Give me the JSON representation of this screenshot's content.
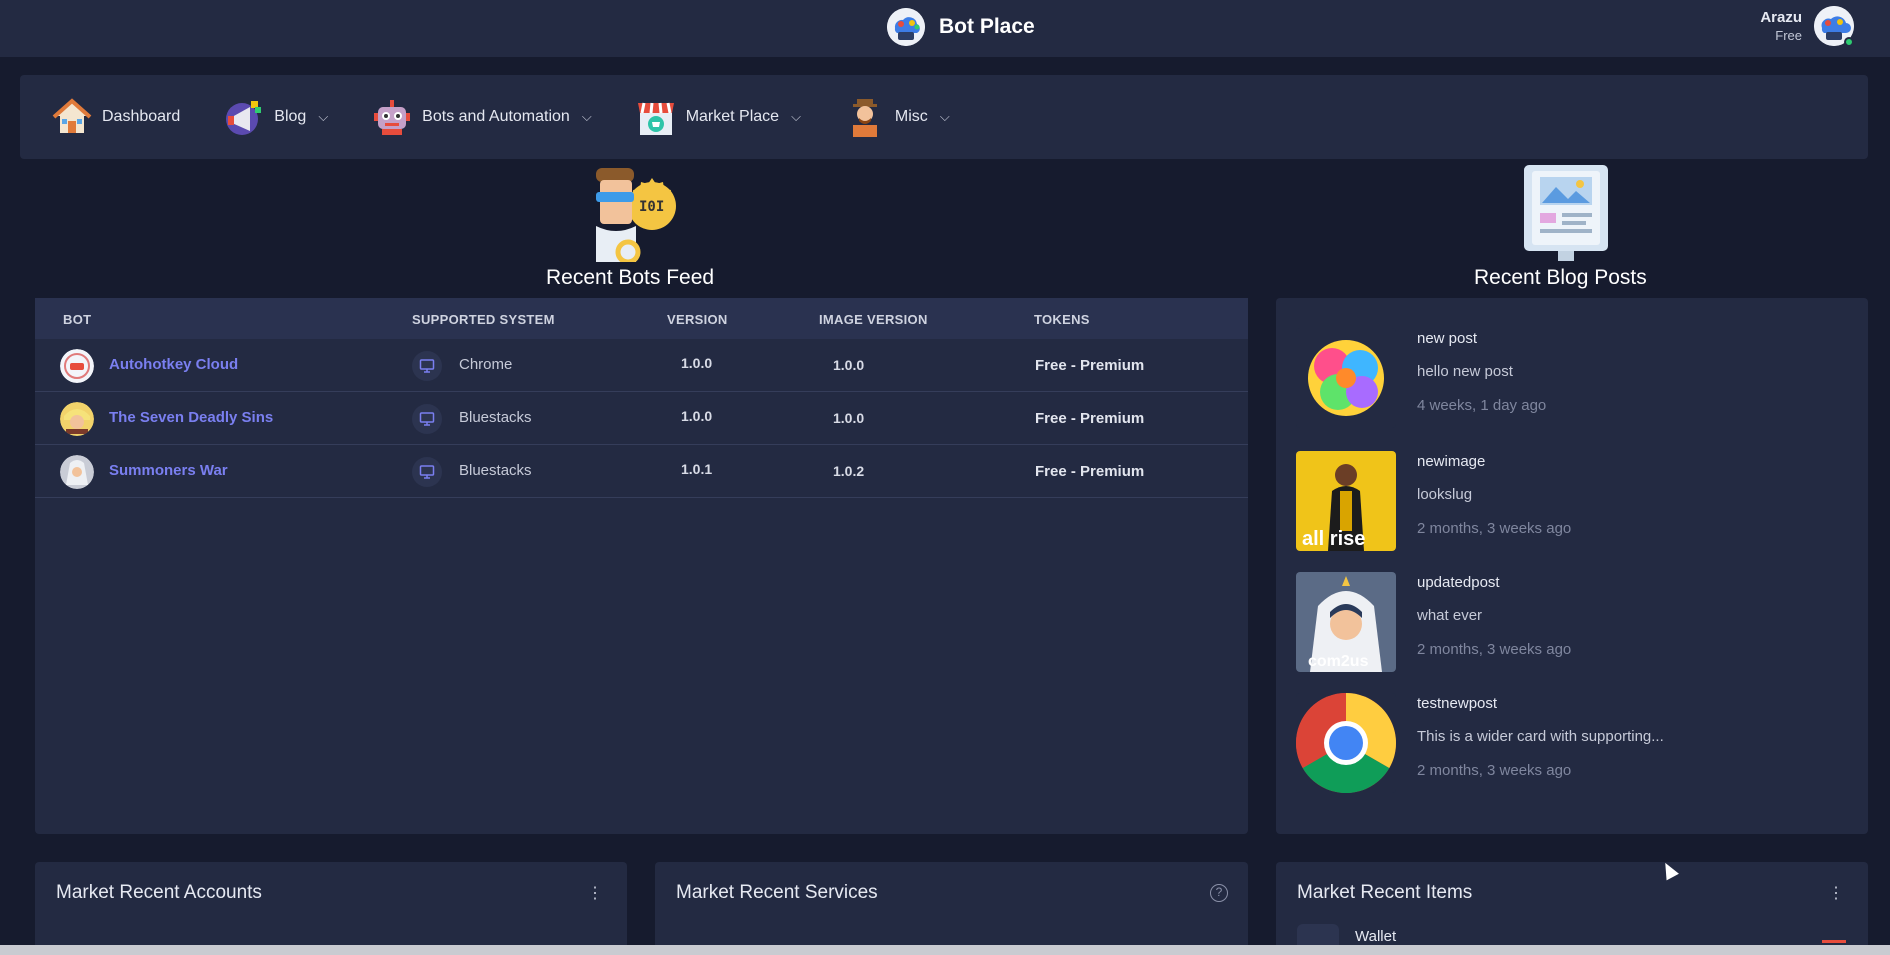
{
  "app": {
    "name": "Bot Place"
  },
  "user": {
    "name": "Arazu",
    "plan": "Free"
  },
  "nav": [
    {
      "label": "Dashboard",
      "icon": "house-icon",
      "dropdown": false
    },
    {
      "label": "Blog",
      "icon": "megaphone-icon",
      "dropdown": true
    },
    {
      "label": "Bots and Automation",
      "icon": "robot-icon",
      "dropdown": true
    },
    {
      "label": "Market Place",
      "icon": "store-icon",
      "dropdown": true
    },
    {
      "label": "Misc",
      "icon": "person-icon",
      "dropdown": true
    }
  ],
  "bots_feed": {
    "title": "Recent Bots Feed",
    "columns": [
      "BOT",
      "SUPPORTED SYSTEM",
      "VERSION",
      "IMAGE VERSION",
      "TOKENS"
    ],
    "rows": [
      {
        "bot": "Autohotkey Cloud",
        "system": "Chrome",
        "version": "1.0.0",
        "image_version": "1.0.0",
        "tokens": "Free - Premium"
      },
      {
        "bot": "The Seven Deadly Sins",
        "system": "Bluestacks",
        "version": "1.0.0",
        "image_version": "1.0.0",
        "tokens": "Free - Premium"
      },
      {
        "bot": "Summoners War",
        "system": "Bluestacks",
        "version": "1.0.1",
        "image_version": "1.0.2",
        "tokens": "Free - Premium"
      }
    ]
  },
  "blog": {
    "title": "Recent Blog Posts",
    "posts": [
      {
        "title": "new post",
        "body": "hello new post",
        "time": "4 weeks, 1 day ago",
        "thumb": "colorful-explosion"
      },
      {
        "title": "newimage",
        "body": "lookslug",
        "time": "2 months, 3 weeks ago",
        "thumb": "all-rise-poster",
        "thumb_text": "all rise"
      },
      {
        "title": "updatedpost",
        "body": "what ever",
        "time": "2 months, 3 weeks ago",
        "thumb": "summoners-war-art",
        "thumb_text": "com2us"
      },
      {
        "title": "testnewpost",
        "body": "This is a wider card with supporting...",
        "time": "2 months, 3 weeks ago",
        "thumb": "chrome-logo"
      }
    ]
  },
  "bottom": {
    "accounts_title": "Market Recent Accounts",
    "services_title": "Market Recent Services",
    "items_title": "Market Recent Items",
    "items_first": "Wallet"
  },
  "colors": {
    "bg": "#161b2e",
    "card": "#232a42",
    "accent": "#7a7ff0"
  }
}
